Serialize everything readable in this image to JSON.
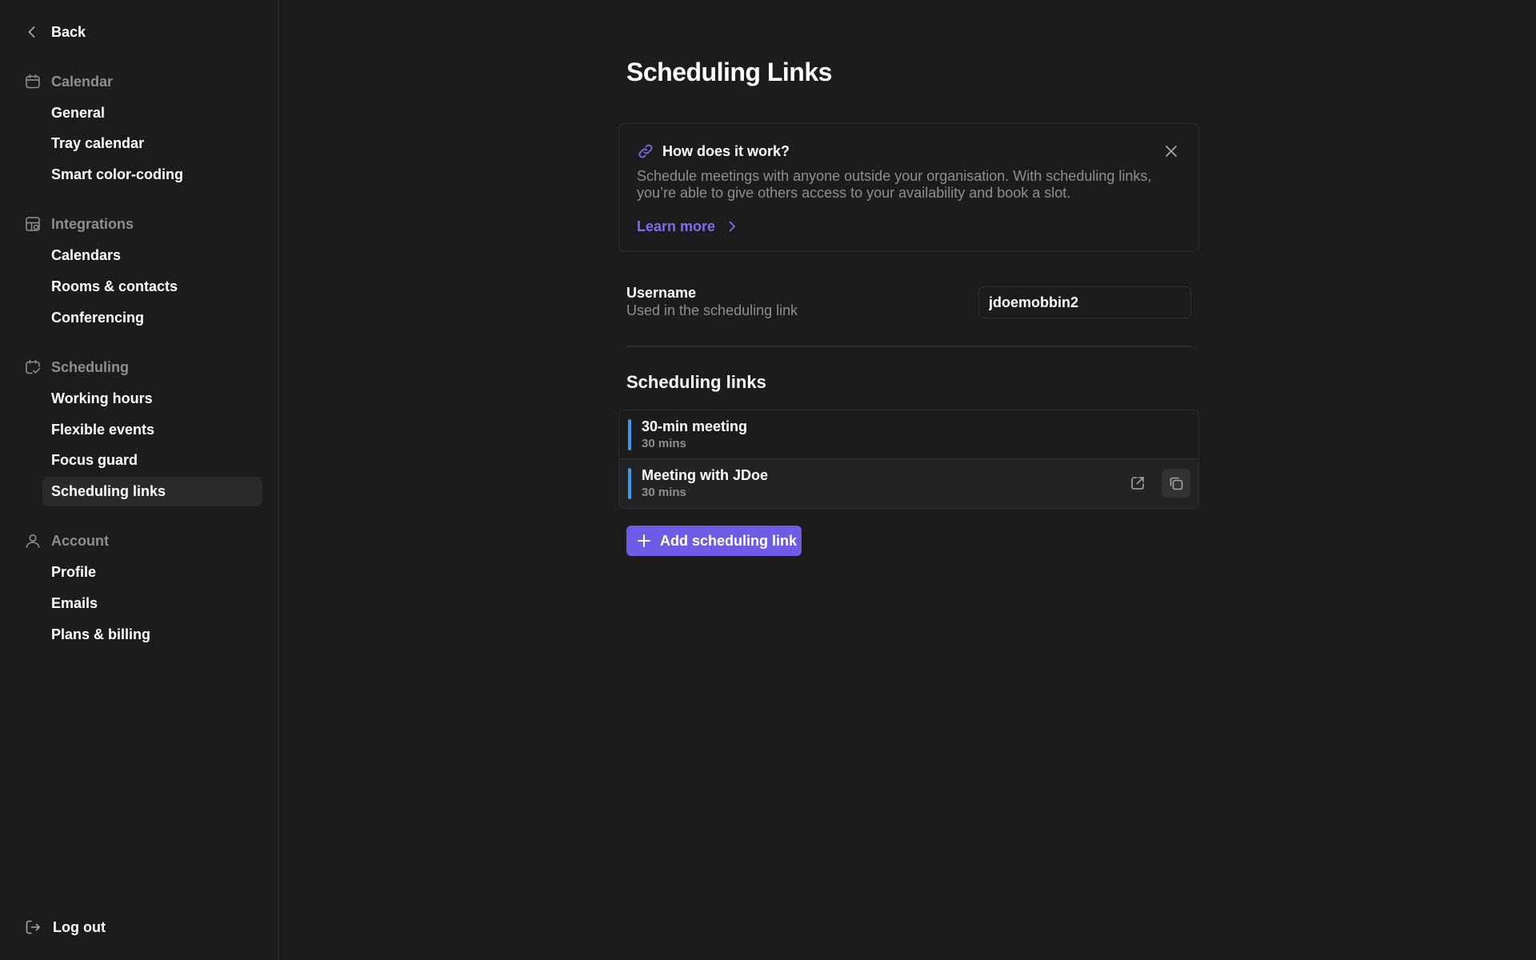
{
  "sidebar": {
    "back_label": "Back",
    "groups": [
      {
        "heading": "Calendar",
        "icon": "calendar-icon",
        "items": [
          "General",
          "Tray calendar",
          "Smart color-coding"
        ]
      },
      {
        "heading": "Integrations",
        "icon": "integrations-icon",
        "items": [
          "Calendars",
          "Rooms & contacts",
          "Conferencing"
        ]
      },
      {
        "heading": "Scheduling",
        "icon": "scheduling-icon",
        "items": [
          "Working hours",
          "Flexible events",
          "Focus guard",
          "Scheduling links"
        ]
      },
      {
        "heading": "Account",
        "icon": "user-icon",
        "items": [
          "Profile",
          "Emails",
          "Plans & billing"
        ]
      }
    ],
    "active_item": "Scheduling links",
    "logout_label": "Log out"
  },
  "main": {
    "title": "Scheduling Links",
    "info": {
      "title": "How does it work?",
      "description": "Schedule meetings with anyone outside your organisation. With scheduling links, you’re able to give others access to your availability and book a slot.",
      "learn_more": "Learn more"
    },
    "username": {
      "label": "Username",
      "sublabel": "Used in the scheduling link",
      "value": "jdoemobbin2"
    },
    "links_section_title": "Scheduling links",
    "links": [
      {
        "name": "30-min meeting",
        "duration": "30 mins",
        "color": "#3b9be8"
      },
      {
        "name": "Meeting with JDoe",
        "duration": "30 mins",
        "color": "#3b9be8"
      }
    ],
    "add_button": "Add scheduling link"
  },
  "colors": {
    "background": "#1c1c1d",
    "accent": "#6e5ce6",
    "link_accent": "#7b6ef2",
    "muted_text": "#8e8e90"
  }
}
